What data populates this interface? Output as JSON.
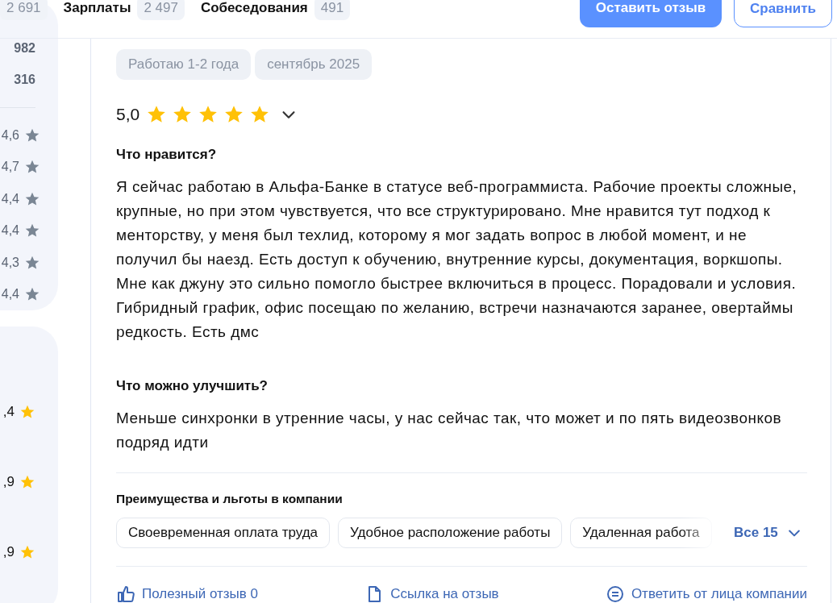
{
  "top_nav": {
    "tabs": [
      {
        "count": "2 691"
      },
      {
        "label": "Зарплаты",
        "count": "2 497"
      },
      {
        "label": "Собеседования",
        "count": "491"
      }
    ],
    "buttons": [
      {
        "label": "Оставить отзыв",
        "kind": "primary"
      },
      {
        "label": "Сравнить",
        "kind": "outline"
      }
    ]
  },
  "sidebar": {
    "counts": [
      "982",
      "316"
    ],
    "ratings": [
      "4,6",
      "4,7",
      "4,4",
      "4,4",
      "4,3",
      "4,4"
    ],
    "scores": [
      ",4",
      ",9",
      ",9"
    ]
  },
  "review": {
    "tags": [
      "Работаю 1-2 года",
      "сентябрь 2025"
    ],
    "rating": "5,0",
    "stars": 5,
    "sections": [
      {
        "title": "Что нравится?",
        "text": "Я сейчас работаю в Альфа-Банке в статусе веб-программиста. Рабочие проекты сложные, крупные, но при этом чувствуется, что все структурировано. Мне нравится тут подход к менторству, у меня был техлид, которому я мог задать вопрос в любой момент, и не получил бы наезд. Есть доступ к обучению, внутренние курсы, документация, воркшопы. Мне как джуну это сильно помогло быстрее включиться в процесс. Порадовали и условия. Гибридный график, офис посещаю по желанию, встречи назначаются заранее, овертаймы редкость. Есть дмс"
      },
      {
        "title": "Что можно улучшить?",
        "text": "Меньше синхронки в утренние часы, у нас сейчас так, что может и по пять видеозвонков подряд идти"
      }
    ],
    "benefits": {
      "title": "Преимущества и льготы в компании",
      "items": [
        "Своевременная оплата труда",
        "Удобное расположение работы",
        "Удаленная работа"
      ],
      "more": "Все 15"
    },
    "actions": [
      {
        "kind": "like",
        "label": "Полезный отзыв 0"
      },
      {
        "kind": "link",
        "label": "Ссылка на отзыв"
      },
      {
        "kind": "reply",
        "label": "Ответить от лица компании"
      }
    ]
  }
}
